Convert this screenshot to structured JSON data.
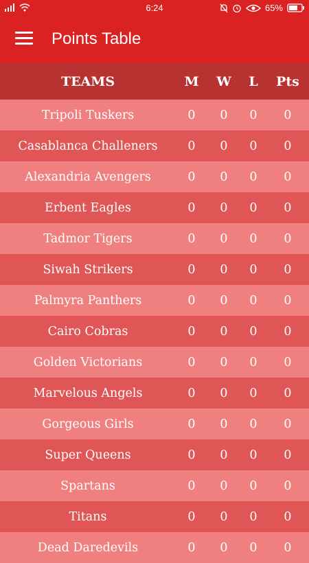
{
  "status_bar": {
    "time": "6:24",
    "battery": "65%",
    "icons": [
      "signal-icon",
      "wifi-icon",
      "bell-muted-icon",
      "alarm-icon",
      "eye-icon",
      "battery-icon"
    ]
  },
  "app_bar": {
    "title": "Points Table"
  },
  "table": {
    "headers": {
      "team": "TEAMS",
      "m": "M",
      "w": "W",
      "l": "L",
      "pts": "Pts"
    },
    "rows": [
      {
        "team": "Tripoli Tuskers",
        "m": "0",
        "w": "0",
        "l": "0",
        "pts": "0"
      },
      {
        "team": "Casablanca Challeners",
        "m": "0",
        "w": "0",
        "l": "0",
        "pts": "0"
      },
      {
        "team": "Alexandria Avengers",
        "m": "0",
        "w": "0",
        "l": "0",
        "pts": "0"
      },
      {
        "team": "Erbent Eagles",
        "m": "0",
        "w": "0",
        "l": "0",
        "pts": "0"
      },
      {
        "team": "Tadmor Tigers",
        "m": "0",
        "w": "0",
        "l": "0",
        "pts": "0"
      },
      {
        "team": "Siwah Strikers",
        "m": "0",
        "w": "0",
        "l": "0",
        "pts": "0"
      },
      {
        "team": "Palmyra Panthers",
        "m": "0",
        "w": "0",
        "l": "0",
        "pts": "0"
      },
      {
        "team": "Cairo Cobras",
        "m": "0",
        "w": "0",
        "l": "0",
        "pts": "0"
      },
      {
        "team": "Golden Victorians",
        "m": "0",
        "w": "0",
        "l": "0",
        "pts": "0"
      },
      {
        "team": "Marvelous Angels",
        "m": "0",
        "w": "0",
        "l": "0",
        "pts": "0"
      },
      {
        "team": "Gorgeous Girls",
        "m": "0",
        "w": "0",
        "l": "0",
        "pts": "0"
      },
      {
        "team": "Super Queens",
        "m": "0",
        "w": "0",
        "l": "0",
        "pts": "0"
      },
      {
        "team": "Spartans",
        "m": "0",
        "w": "0",
        "l": "0",
        "pts": "0"
      },
      {
        "team": "Titans",
        "m": "0",
        "w": "0",
        "l": "0",
        "pts": "0"
      },
      {
        "team": "Dead Daredevils",
        "m": "0",
        "w": "0",
        "l": "0",
        "pts": "0"
      }
    ]
  },
  "colors": {
    "app_bar": "#db2222",
    "header_row": "#b83232",
    "row_light": "#f07f80",
    "row_dark": "#e05555"
  }
}
